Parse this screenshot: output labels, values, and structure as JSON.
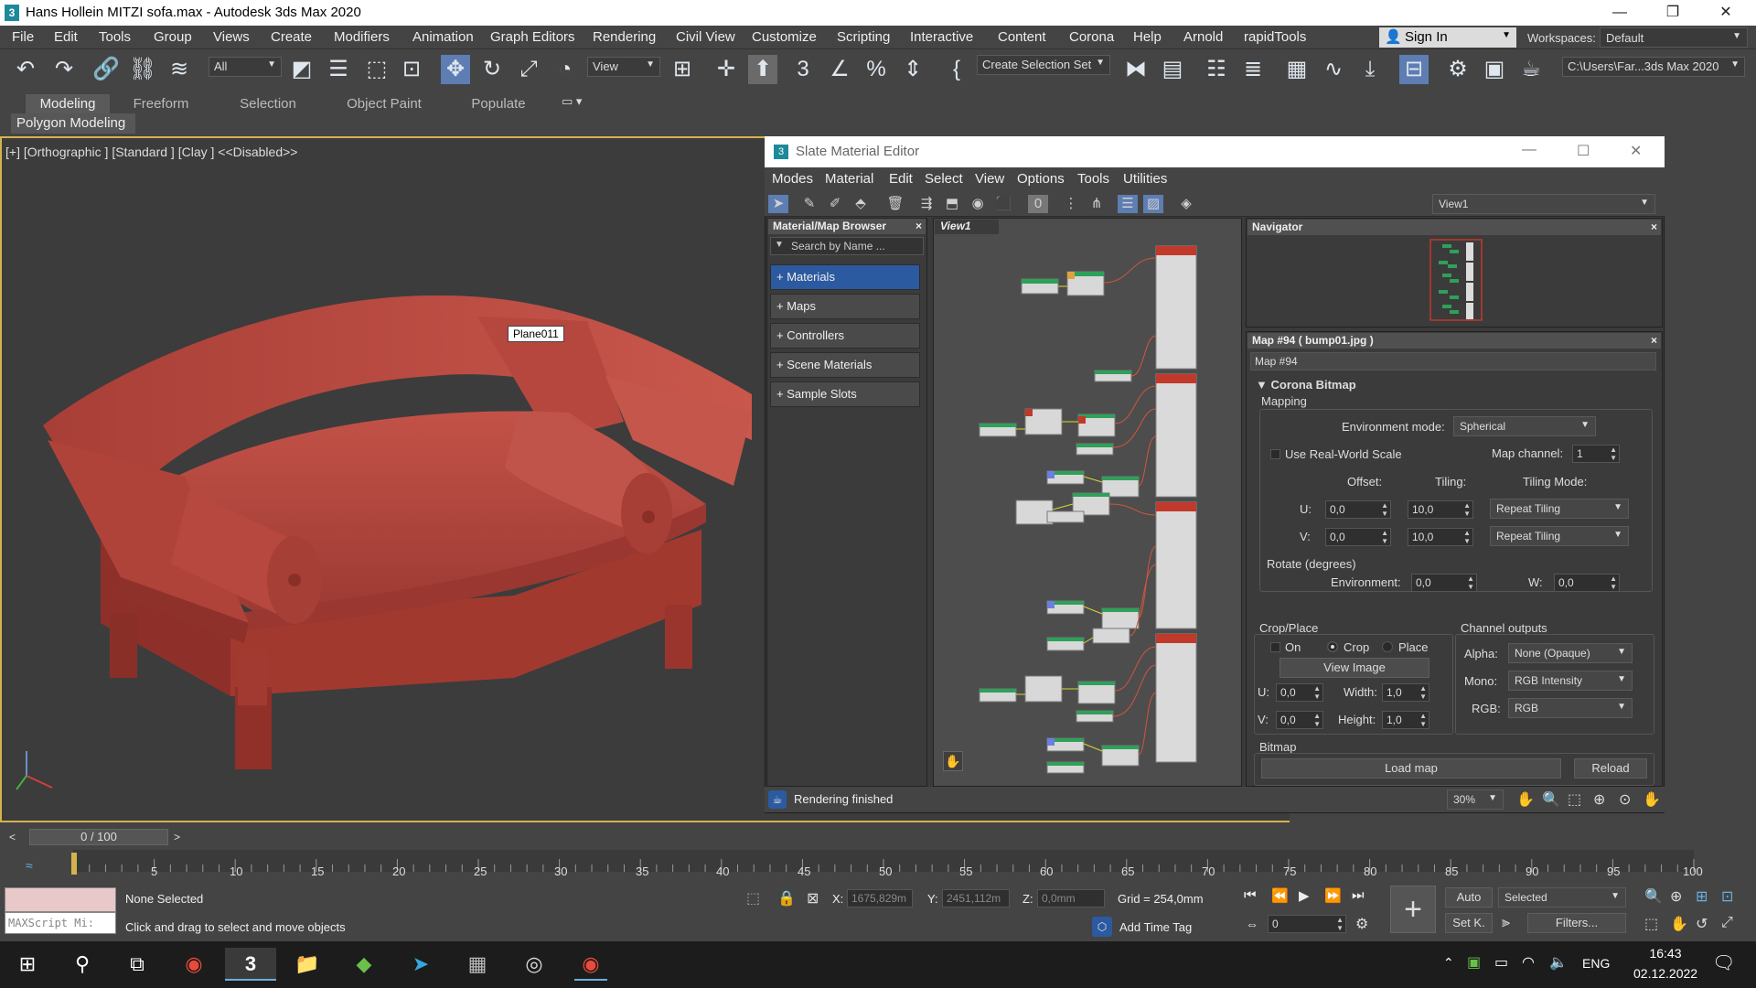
{
  "window": {
    "title": "Hans Hollein MITZI sofa.max - Autodesk 3ds Max 2020",
    "app_icon_glyph": "3",
    "min": "—",
    "max": "❐",
    "close": "✕"
  },
  "menus": [
    "File",
    "Edit",
    "Tools",
    "Group",
    "Views",
    "Create",
    "Modifiers",
    "Animation",
    "Graph Editors",
    "Rendering",
    "Civil View",
    "Customize",
    "Scripting",
    "Interactive",
    "Content",
    "Corona",
    "Help",
    "Arnold",
    "rapidTools"
  ],
  "signin": "Sign In",
  "workspaces_label": "Workspaces:",
  "workspace_value": "Default",
  "toolbar": {
    "selection_filter": "All",
    "ref_coord": "View",
    "named_sel": "Create Selection Set",
    "project_path": "C:\\Users\\Far...3ds Max 2020"
  },
  "ribbon": {
    "tabs": [
      "Modeling",
      "Freeform",
      "Selection",
      "Object Paint",
      "Populate"
    ],
    "sub": "Polygon Modeling"
  },
  "viewport": {
    "label": "[+] [Orthographic ] [Standard ] [Clay ]  <<Disabled>>",
    "object_label": "Plane011"
  },
  "slate": {
    "title": "Slate Material Editor",
    "menus": [
      "Modes",
      "Material",
      "Edit",
      "Select",
      "View",
      "Options",
      "Tools",
      "Utilities"
    ],
    "view_select": "View1",
    "browser": {
      "title": "Material/Map Browser",
      "search": "Search by Name ...",
      "items": [
        "+ Materials",
        "+ Maps",
        "+ Controllers",
        "+ Scene Materials",
        "+ Sample Slots"
      ]
    },
    "view_tab": "View1",
    "navigator": "Navigator",
    "map_title": "Map #94  ( bump01.jpg )",
    "map_name": "Map #94",
    "rollout": "Corona Bitmap",
    "mapping": "Mapping",
    "env_mode_label": "Environment mode:",
    "env_mode": "Spherical",
    "real_world": "Use Real-World Scale",
    "map_channel_label": "Map channel:",
    "map_channel": "1",
    "offset_label": "Offset:",
    "tiling_label": "Tiling:",
    "tiling_mode_label": "Tiling Mode:",
    "u_label": "U:",
    "v_label": "V:",
    "u_offset": "0,0",
    "v_offset": "0,0",
    "u_tiling": "10,0",
    "v_tiling": "10,0",
    "u_mode": "Repeat Tiling",
    "v_mode": "Repeat Tiling",
    "rotate_label": "Rotate (degrees)",
    "env_label": "Environment:",
    "env_value": "0,0",
    "w_label": "W:",
    "w_value": "0,0",
    "crop_place": "Crop/Place",
    "on": "On",
    "crop": "Crop",
    "place": "Place",
    "view_image": "View Image",
    "crop_u": "0,0",
    "crop_v": "0,0",
    "width_label": "Width:",
    "width": "1,0",
    "height_label": "Height:",
    "height": "1,0",
    "channel_outputs": "Channel outputs",
    "alpha_label": "Alpha:",
    "alpha": "None (Opaque)",
    "mono_label": "Mono:",
    "mono": "RGB Intensity",
    "rgb_label": "RGB:",
    "rgb": "RGB",
    "bitmap": "Bitmap",
    "load_map": "Load map",
    "reload": "Reload",
    "status": "Rendering finished",
    "zoom": "30%"
  },
  "timeline": {
    "frame": "0 / 100",
    "ticks": [
      "5",
      "10",
      "15",
      "20",
      "25",
      "30",
      "35",
      "40",
      "45",
      "50",
      "55",
      "60",
      "65",
      "70",
      "75",
      "80",
      "85",
      "90",
      "95",
      "100"
    ]
  },
  "status": {
    "selection": "None Selected",
    "prompt": "Click and drag to select and move objects",
    "maxscript": "MAXScript Mi:",
    "x_label": "X:",
    "x": "1675,829m",
    "y_label": "Y:",
    "y": "2451,112m",
    "z_label": "Z:",
    "z": "0,0mm",
    "grid": "Grid = 254,0mm",
    "add_time_tag": "Add Time Tag",
    "auto": "Auto",
    "selected": "Selected",
    "setk": "Set K.",
    "filters": "Filters...",
    "frame_field": "0"
  },
  "taskbar": {
    "lang": "ENG",
    "time": "16:43",
    "date": "02.12.2022"
  },
  "colors": {
    "sofa": "#b5463d",
    "accent": "#2c5aa0",
    "viewport_border": "#d6b24e"
  }
}
